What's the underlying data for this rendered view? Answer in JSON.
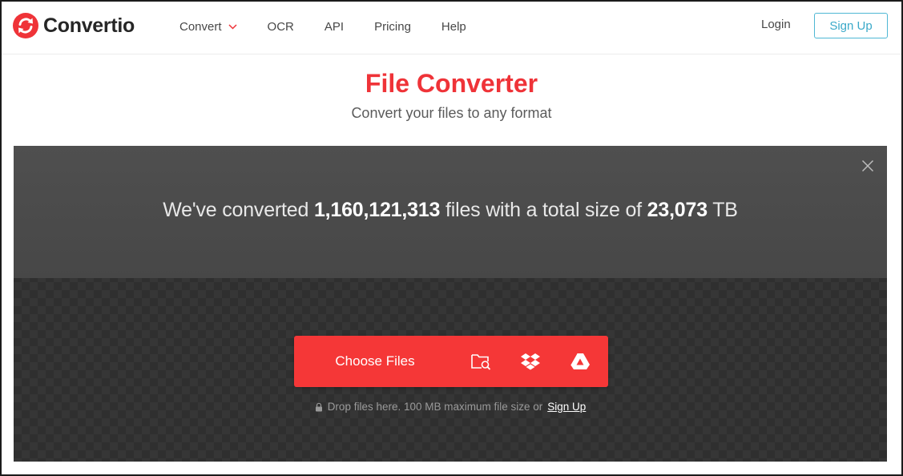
{
  "brand": {
    "name": "Convertio",
    "color": "#ef3338"
  },
  "nav": {
    "items": [
      {
        "label": "Convert",
        "has_dropdown": true
      },
      {
        "label": "OCR"
      },
      {
        "label": "API"
      },
      {
        "label": "Pricing"
      },
      {
        "label": "Help"
      }
    ],
    "login_label": "Login",
    "signup_label": "Sign Up"
  },
  "hero": {
    "title": "File Converter",
    "subtitle": "Convert your files to any format"
  },
  "stats": {
    "prefix": "We've converted",
    "files_count": "1,160,121,313",
    "middle": "files with a total size of",
    "total_size": "23,073",
    "unit": "TB"
  },
  "uploader": {
    "choose_label": "Choose Files",
    "sources": [
      "folder-search-icon",
      "dropbox-icon",
      "google-drive-icon"
    ],
    "drop_note": "Drop files here. 100 MB maximum file size or",
    "signup_link": "Sign Up",
    "accent": "#f53737"
  }
}
